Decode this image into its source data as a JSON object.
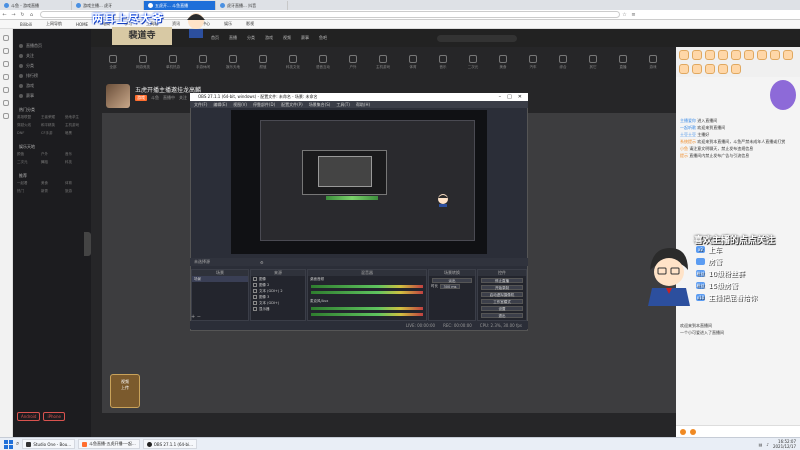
{
  "browser": {
    "tabs": [
      {
        "label": "斗鱼 - 游戏直播",
        "active": false
      },
      {
        "label": "游戏主播... 虎牙",
        "active": false
      },
      {
        "label": "五虎开... 斗鱼直播",
        "active": true
      },
      {
        "label": "虎牙直播... 抖音",
        "active": false
      }
    ],
    "url": "",
    "bookmarks": [
      "Bilibili",
      "上网导航",
      "HOME",
      "电商",
      "学习",
      "工具箱",
      "资讯",
      "游戏中心",
      "娱乐",
      "影视"
    ]
  },
  "overlay": {
    "banner_title": "两耳上尽大爷",
    "banner_subtitle": "裴道寺"
  },
  "sitenav": {
    "items": [
      "直播首页",
      "关注",
      "分类",
      "排行榜",
      "游戏",
      "赛事"
    ],
    "sections": [
      {
        "title": "热门分类",
        "cells": [
          "英雄联盟",
          "王者荣耀",
          "绝地求生",
          "穿越火线",
          "和平精英",
          "主机游戏",
          "DNF",
          "CF手游",
          "暗黑"
        ]
      },
      {
        "title": "娱乐天地",
        "cells": [
          "颜值",
          "户外",
          "音乐",
          "二次元",
          "舞蹈",
          "科技"
        ]
      },
      {
        "title": "推荐",
        "cells": [
          "一起看",
          "美食",
          "体育",
          "热门",
          "新秀",
          "旅游"
        ]
      }
    ],
    "bottom_buttons": [
      "Android",
      "iPhone"
    ]
  },
  "topnav": {
    "items": [
      "首页",
      "直播",
      "分类",
      "游戏",
      "视频",
      "赛事",
      "鱼吧"
    ]
  },
  "categories": [
    "全部",
    "网游竞技",
    "单机热游",
    "手游休闲",
    "娱乐天地",
    "颜值",
    "科技文化",
    "语音互动",
    "户外",
    "主机游戏",
    "体育",
    "音乐",
    "二次元",
    "美食",
    "汽车",
    "综合",
    "其它",
    "直播",
    "游戏",
    "新秀"
  ],
  "room": {
    "title": "五虎开播主播邀挂龙高麟",
    "tag": "游戏",
    "sub": [
      "斗鱼",
      "直播中",
      "关注"
    ]
  },
  "obs": {
    "window_title": "OBS 27.1.1 (64-bit, windows) - 配置文件: 未命名 - 场景: 未命名",
    "menu": [
      "文件(F)",
      "编辑(E)",
      "视图(V)",
      "停靠部件(D)",
      "配置文件(P)",
      "场景集合(S)",
      "工具(T)",
      "帮助(H)"
    ],
    "controls_bar": "未选择源",
    "docks": {
      "scenes": {
        "title": "场景",
        "items": [
          "场景"
        ]
      },
      "sources": {
        "title": "来源",
        "items": [
          "图像",
          "图像 2",
          "文本 (GDI+) 2",
          "图像 3",
          "文本 (GDI+)",
          "显示器"
        ]
      },
      "mixer": {
        "title": "混音器",
        "items": [
          "桌面音频",
          "麦克风/Aux"
        ]
      },
      "transitions": {
        "title": "场景转换",
        "fade": "淡出",
        "duration_label": "时长",
        "duration": "300 ms"
      },
      "controls": {
        "title": "控件",
        "buttons": [
          "停止直播",
          "开始录制",
          "启动虚拟摄像机",
          "工作室模式",
          "设置",
          "退出"
        ]
      }
    },
    "status": [
      "LIVE: 00:00:00",
      "REC: 00:00:00",
      "CPU: 2.3%, 30.00 fps"
    ]
  },
  "chat": {
    "messages": [
      {
        "name": "主播爱你",
        "text": "进入直播间",
        "style": "blue"
      },
      {
        "name": "一起听歌",
        "text": "欢迎来到直播间",
        "style": "blue"
      },
      {
        "name": "土豆土豆",
        "text": "主播好",
        "style": "blue"
      },
      {
        "name": "系统提示",
        "text": "欢迎来到本直播间，斗鱼严禁未成年人直播或打赏",
        "style": "orange"
      },
      {
        "name": "小鱼",
        "text": "请注意文明聊天，禁止发布违规信息",
        "style": "orange"
      },
      {
        "name": "提示",
        "text": "直播间内禁止发布广告与引流信息",
        "style": "orange"
      }
    ],
    "subscribe_title": "喜欢主播的点点关注",
    "subscribe_lines": [
      {
        "badge": "x2",
        "text": "上车"
      },
      {
        "badge": "",
        "text": "房管"
      },
      {
        "badge": "粉丝",
        "text": "10级粉丝群"
      },
      {
        "badge": "粉丝",
        "text": "15级房管"
      },
      {
        "badge": "x10",
        "text": "主播把屁看给你"
      }
    ],
    "bottom_chat": [
      "欢迎来到本直播间",
      "一个小可爱进入了直播间"
    ]
  },
  "sidebadge": {
    "line1": "视频",
    "line2": "上传"
  },
  "taskbar": {
    "items": [
      {
        "label": "Studio One - Bou...",
        "kind": "studio"
      },
      {
        "label": "斗鱼直播-五虎开播-一起...",
        "kind": "browser"
      },
      {
        "label": "OBS 27.1.1 (64-bi...",
        "kind": "obs"
      }
    ],
    "time": "16:52:07",
    "date": "2021/12/17"
  }
}
